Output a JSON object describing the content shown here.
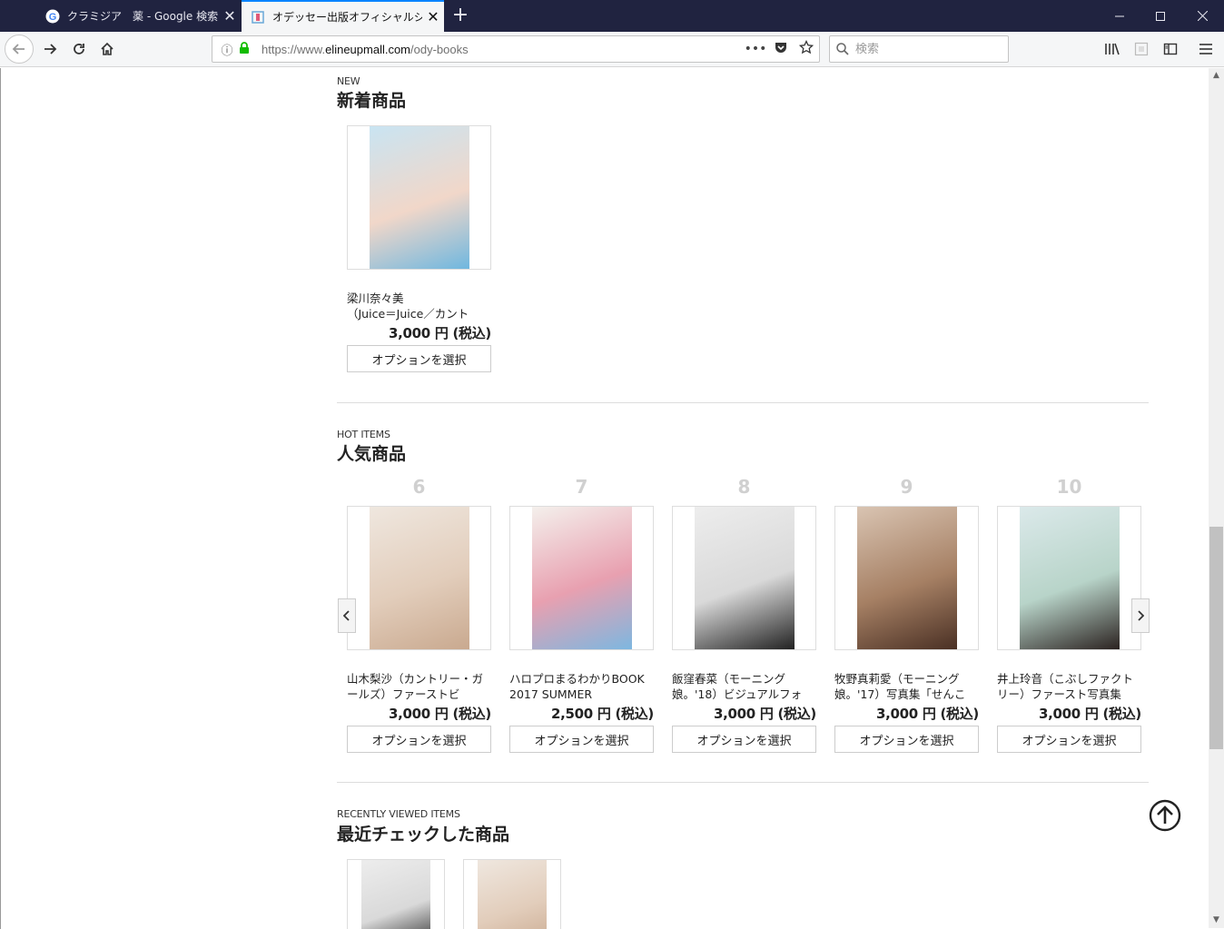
{
  "browser": {
    "tabs": [
      {
        "title": "クラミジア　薬 - Google 検索",
        "active": false
      },
      {
        "title": "オデッセー出版オフィシャルショップ | エ",
        "active": true
      }
    ],
    "url_prefix": "https://www.",
    "url_domain": "elineupmall.com",
    "url_path": "/ody-books",
    "search_placeholder": "検索"
  },
  "new_items": {
    "label": "NEW",
    "title": "新着商品",
    "products": [
      {
        "name": "梁川奈々美\n（Juice＝Juice／カント",
        "price": "3,000 円 (税込)",
        "button": "オプションを選択",
        "tone": [
          "#c9e4f2",
          "#f1d7c9",
          "#6fb7df"
        ]
      }
    ]
  },
  "hot_items": {
    "label": "HOT ITEMS",
    "title": "人気商品",
    "products": [
      {
        "rank": "6",
        "name": "山木梨沙（カントリー・ガールズ）ファーストビ",
        "price": "3,000 円 (税込)",
        "button": "オプションを選択",
        "tone": [
          "#efe7df",
          "#e2cdbb",
          "#c9a98f"
        ]
      },
      {
        "rank": "7",
        "name": "ハロプロまるわかりBOOK 2017 SUMMER",
        "price": "2,500 円 (税込)",
        "button": "オプションを選択",
        "tone": [
          "#f4f0ec",
          "#e8a0b0",
          "#7db7e0"
        ]
      },
      {
        "rank": "8",
        "name": "飯窪春菜（モーニング娘。'18）ビジュアルフォ",
        "price": "3,000 円 (税込)",
        "button": "オプションを選択",
        "tone": [
          "#ededed",
          "#d9d9d9",
          "#222222"
        ]
      },
      {
        "rank": "9",
        "name": "牧野真莉愛（モーニング娘。'17）写真集「せんこ",
        "price": "3,000 円 (税込)",
        "button": "オプションを選択",
        "tone": [
          "#d9c4b2",
          "#a68064",
          "#4a3024"
        ]
      },
      {
        "rank": "10",
        "name": "井上玲音（こぶしファクトリー）ファースト写真集",
        "price": "3,000 円 (税込)",
        "button": "オプションを選択",
        "tone": [
          "#dbe9ea",
          "#b8d4c9",
          "#2b2220"
        ]
      }
    ]
  },
  "recent_items": {
    "label": "RECENTLY VIEWED ITEMS",
    "title": "最近チェックした商品",
    "thumbs": [
      {
        "tone": [
          "#ededed",
          "#d9d9d9",
          "#222222"
        ]
      },
      {
        "tone": [
          "#efe7df",
          "#e2cdbb",
          "#c9a98f"
        ]
      }
    ]
  }
}
